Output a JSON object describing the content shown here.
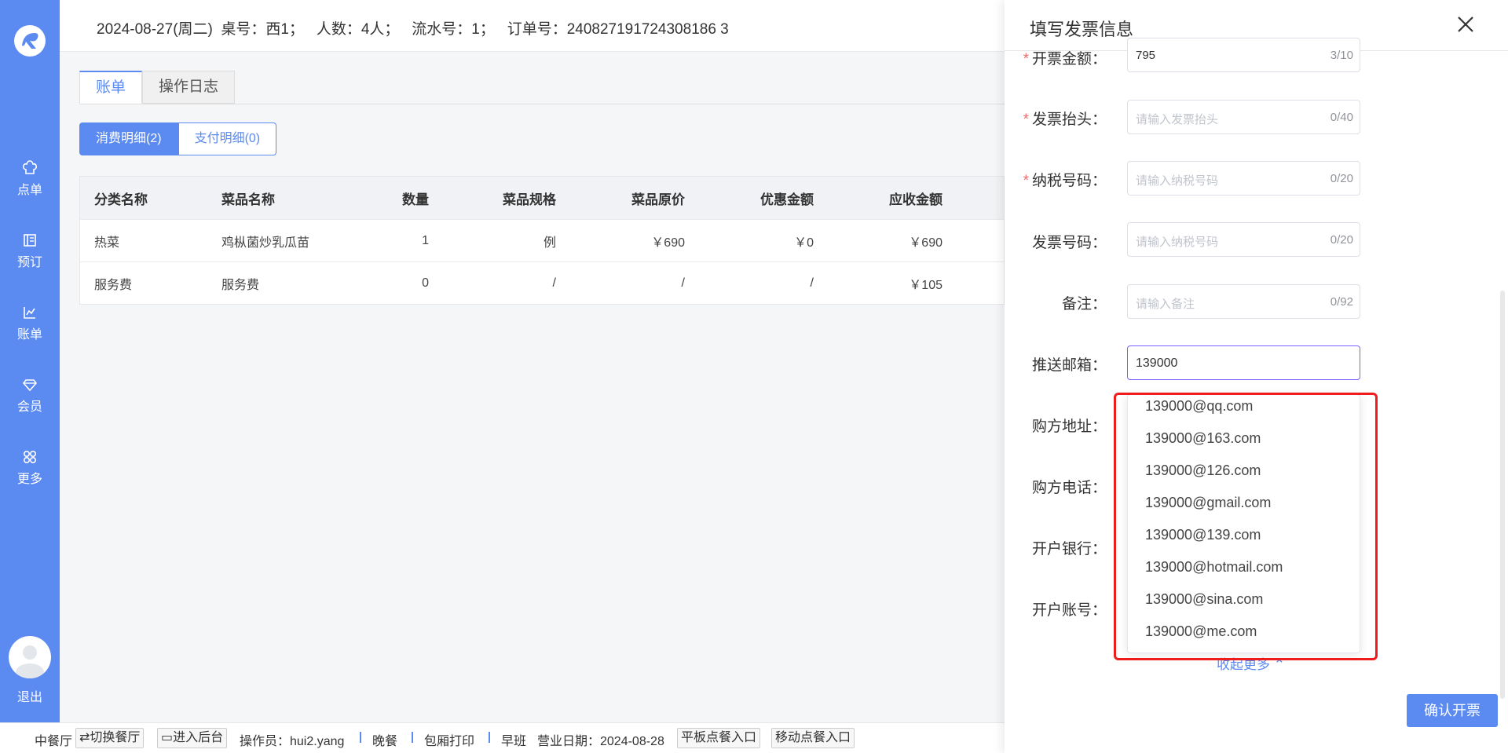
{
  "colors": {
    "brand": "#5b8af0",
    "required": "#f56c6c",
    "highlight": "#ee1c1c"
  },
  "sidebar": {
    "items": [
      {
        "label": "点单",
        "icon": "chef-hat-icon"
      },
      {
        "label": "预订",
        "icon": "book-icon"
      },
      {
        "label": "账单",
        "icon": "chart-icon"
      },
      {
        "label": "会员",
        "icon": "diamond-icon"
      },
      {
        "label": "更多",
        "icon": "grid-icon"
      }
    ],
    "logout": "退出"
  },
  "header": {
    "date": "2024-08-27(周二)",
    "table": "桌号：西1；",
    "people": "人数：4人；",
    "serial": "流水号：1；",
    "order": "订单号：240827191724308186 3"
  },
  "tabs": [
    "账单",
    "操作日志"
  ],
  "segments": [
    "消费明细(2)",
    "支付明细(0)"
  ],
  "table": {
    "headers": [
      "分类名称",
      "菜品名称",
      "数量",
      "菜品规格",
      "菜品原价",
      "优惠金额",
      "应收金额"
    ],
    "rows": [
      [
        "热菜",
        "鸡枞菌炒乳瓜苗",
        "1",
        "例",
        "￥690",
        "￥0",
        "￥690"
      ],
      [
        "服务费",
        "服务费",
        "0",
        "/",
        "/",
        "/",
        "￥105"
      ]
    ]
  },
  "footer": {
    "hall": "中餐厅",
    "switch": "⇄切换餐厅",
    "backend": "进入后台",
    "operator": "操作员：hui2.yang",
    "meal": "晚餐",
    "print": "包厢打印",
    "shift": "早班",
    "bizdate": "营业日期：2024-08-28",
    "tablet": "平板点餐入口",
    "mobile": "移动点餐入口"
  },
  "drawer": {
    "title": "填写发票信息",
    "fields": [
      {
        "label": "开票金额：",
        "required": true,
        "value": "795",
        "placeholder": "",
        "count": "3/10"
      },
      {
        "label": "发票抬头：",
        "required": true,
        "value": "",
        "placeholder": "请输入发票抬头",
        "count": "0/40"
      },
      {
        "label": "纳税号码：",
        "required": true,
        "value": "",
        "placeholder": "请输入纳税号码",
        "count": "0/20"
      },
      {
        "label": "发票号码：",
        "required": false,
        "value": "",
        "placeholder": "请输入纳税号码",
        "count": "0/20"
      },
      {
        "label": "备注：",
        "required": false,
        "value": "",
        "placeholder": "请输入备注",
        "count": "0/92"
      },
      {
        "label": "推送邮箱：",
        "required": false,
        "value": "139000",
        "placeholder": "",
        "count": ""
      }
    ],
    "hidden_labels": [
      "购方地址：",
      "购方电话：",
      "开户银行：",
      "开户账号："
    ],
    "suggestions": [
      "139000@qq.com",
      "139000@163.com",
      "139000@126.com",
      "139000@gmail.com",
      "139000@139.com",
      "139000@hotmail.com",
      "139000@sina.com",
      "139000@me.com"
    ],
    "collapse": "收起更多",
    "confirm": "确认开票"
  }
}
